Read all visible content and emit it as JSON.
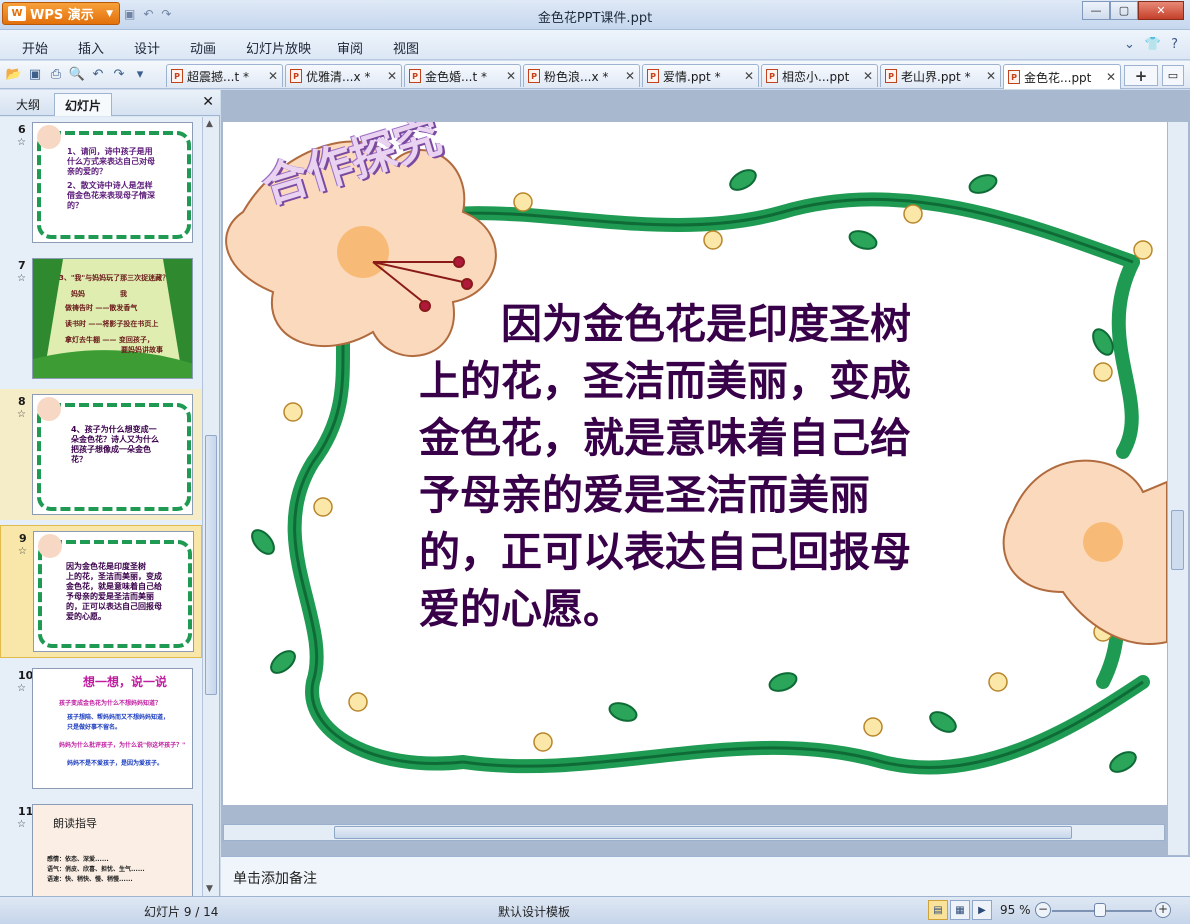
{
  "app": {
    "brand": "WPS 演示",
    "window_title": "金色花PPT课件.ppt"
  },
  "menu": [
    "开始",
    "插入",
    "设计",
    "动画",
    "幻灯片放映",
    "审阅",
    "视图"
  ],
  "doc_tabs": [
    {
      "label": "超震撼...t *"
    },
    {
      "label": "优雅清...x *"
    },
    {
      "label": "金色婚...t *"
    },
    {
      "label": "粉色浪...x *"
    },
    {
      "label": "爱情.ppt *"
    },
    {
      "label": "相恋小...ppt"
    },
    {
      "label": "老山界.ppt *"
    },
    {
      "label": "金色花...ppt"
    }
  ],
  "panel": {
    "tabs": [
      "大纲",
      "幻灯片"
    ],
    "slides": [
      {
        "num": "6",
        "lines": [
          "1、请问，诗中孩子是用",
          "什么方式来表达自己对母",
          "亲的爱的？",
          "2、散文诗中诗人是怎样",
          "借金色花来表现母子情深",
          "的？"
        ]
      },
      {
        "num": "7",
        "lines": [
          "3、\"我\"与妈妈玩了那三次捉迷藏？",
          "妈妈　　　　　我",
          "做祷告时 ——散发香气",
          "读书时 ——将影子投在书页上",
          "拿灯去牛棚 —— 变回孩子，",
          "要妈妈讲故事"
        ]
      },
      {
        "num": "8",
        "lines": [
          "4、孩子为什么想变成一",
          "朵金色花？诗人又为什么",
          "把孩子想像成一朵金色",
          "花？"
        ]
      },
      {
        "num": "9",
        "lines": [
          "因为金色花是印度圣树",
          "上的花，圣洁而美丽，变成",
          "金色花，就是意味着自己给",
          "予母亲的爱是圣洁而美丽",
          "的，正可以表达自己回报母",
          "爱的心愿。"
        ]
      },
      {
        "num": "10",
        "lines": [
          "想一想，说一说",
          "孩子变成金色花为什么不想妈妈知道？",
          "孩子想陪、帮妈妈而又不想妈妈知道，",
          "只是做好事不留名。",
          "妈妈为什么批评孩子，为什么说\"你这坏孩子？\"",
          "妈妈不是不爱孩子，是因为爱孩子。"
        ]
      },
      {
        "num": "11",
        "lines": [
          "朗读指导",
          "感情：依恋、深爱......",
          "语气：俏皮、欣喜、担忧、生气......",
          "语速：快、稍快、慢、稍慢......"
        ]
      }
    ]
  },
  "slide": {
    "title": "合作探究",
    "body": [
      "　　因为金色花是印度圣树",
      "上的花，圣洁而美丽，变成",
      "金色花，就是意味着自己给",
      "予母亲的爱是圣洁而美丽",
      "的，正可以表达自己回报母",
      "爱的心愿。"
    ]
  },
  "notes_placeholder": "单击添加备注",
  "status": {
    "slide_counter": "幻灯片 9 / 14",
    "template": "默认设计模板",
    "zoom": "95 %"
  },
  "colors": {
    "accent": "#e3700b",
    "slide_text": "#39004a",
    "vine": "#1e9a52",
    "selected_thumb": "#f8e7a8"
  }
}
